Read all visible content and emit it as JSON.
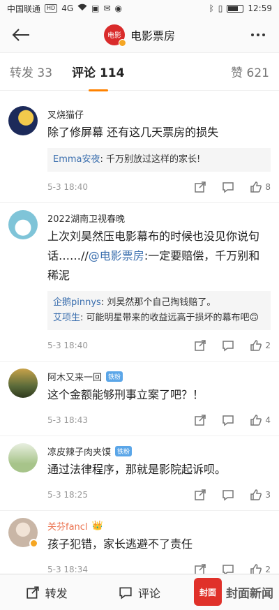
{
  "status": {
    "carrier": "中国联通",
    "time": "12:59",
    "network": "4G"
  },
  "nav": {
    "title": "电影票房",
    "logo_text": "电影"
  },
  "tabs": {
    "repost": "转发 33",
    "comments": "评论 114",
    "likes": "赞 621"
  },
  "comments": [
    {
      "name": "叉烧猫仔",
      "text": "除了修屏幕 还有这几天票房的损失",
      "replies": [
        {
          "name": "Emma安夜",
          "text": ": 千万别放过这样的家长!"
        }
      ],
      "time": "5-3 18:40",
      "likes": "8",
      "avatar_color": "#1c2a5a"
    },
    {
      "name": "2022湖南卫视春晚",
      "text_prefix": "上次刘昊然压电影幕布的时候也没见你说句话……//",
      "mention": "@电影票房",
      "text_suffix": ":一定要赔偿，千万别和稀泥",
      "replies": [
        {
          "name": "企鹅pinnys",
          "text": ": 刘昊然那个自己掏钱赔了。"
        },
        {
          "name": "艾项生",
          "text": ": 可能明星带来的收益远高于损坏的幕布吧🙃"
        }
      ],
      "time": "5-3 18:40",
      "likes": "2",
      "avatar_color": "#7fc4d8"
    },
    {
      "name": "阿木又来一回",
      "badge": "铁粉",
      "text": "这个金额能够刑事立案了吧？！",
      "time": "5-3 18:43",
      "likes": "4",
      "avatar_color": "#5b6b3a"
    },
    {
      "name": "凉皮辣子肉夹馍",
      "badge": "铁粉",
      "text": "通过法律程序，那就是影院起诉呗。",
      "time": "5-3 18:25",
      "likes": "3",
      "avatar_color": "#a7c48a"
    },
    {
      "name": "关芬fancl",
      "crown": "👑",
      "text": "孩子犯错，家长逃避不了责任",
      "time": "5-3 18:34",
      "likes": "2",
      "avatar_color": "#c9b6a6"
    }
  ],
  "bottom": {
    "repost": "转发",
    "comment": "评论"
  },
  "watermark": {
    "logo": "封面",
    "text": "封面新闻"
  },
  "colors": {
    "accent": "#ff8200",
    "link": "#3b6fae",
    "fan_badge": "#5ba6e8"
  }
}
